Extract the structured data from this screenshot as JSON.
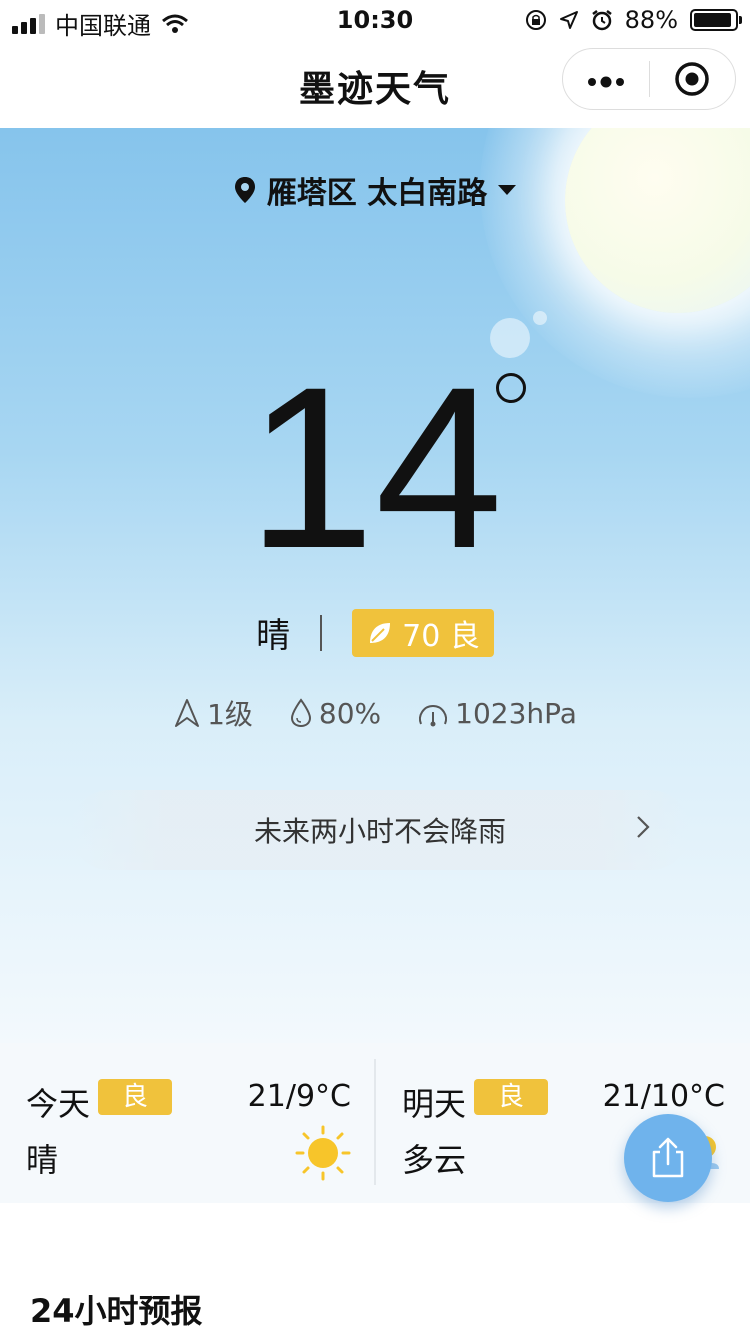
{
  "status_bar": {
    "carrier": "中国联通",
    "time": "10:30",
    "battery": "88%",
    "battery_level": 0.88,
    "icons": [
      "signal-icon",
      "wifi-icon",
      "lock-rotation-icon",
      "location-arrow-icon",
      "alarm-icon",
      "battery-icon"
    ]
  },
  "nav": {
    "title": "墨迹天气",
    "more_label": "•●•",
    "icons": [
      "more-icon",
      "close-target-icon"
    ]
  },
  "hero": {
    "location": "雁塔区 太白南路",
    "temperature": "14",
    "condition": "晴",
    "aqi_value": "70",
    "aqi_label": "良",
    "aqi_text": "70 良",
    "wind": "1级",
    "humidity": "80%",
    "pressure": "1023hPa",
    "rain_notice": "未来两小时不会降雨",
    "colors": {
      "aqi_badge": "#f0c23c",
      "sky_top": "#86c4ec"
    }
  },
  "daily": {
    "today": {
      "name": "今天",
      "quality": "良",
      "range": "21/9°C",
      "weather": "晴",
      "icon": "sun-icon"
    },
    "tomorrow": {
      "name": "明天",
      "quality": "良",
      "range": "21/10°C",
      "weather": "多云",
      "icon": "partly-cloudy-icon"
    }
  },
  "share": {
    "icon": "share-icon"
  },
  "forecast_section": {
    "title": "24小时预报"
  }
}
